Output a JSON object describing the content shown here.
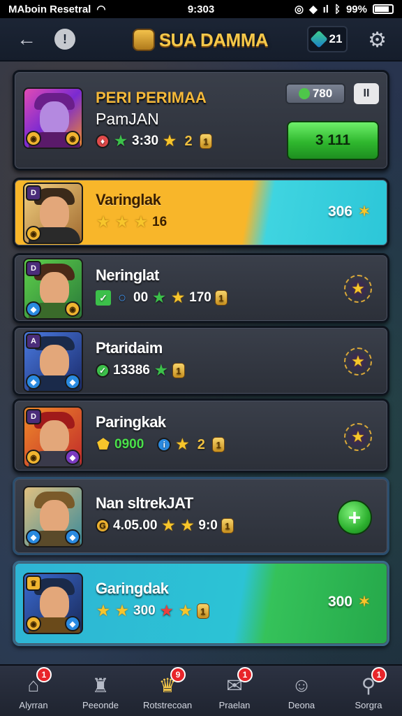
{
  "status_bar": {
    "carrier": "MAboin Resetral",
    "time": "9:303",
    "battery": "99%"
  },
  "header": {
    "title": "SUA DAMMA",
    "gems": "21"
  },
  "top_card": {
    "title_line1": "PERI PERIMAA",
    "title_line2": "PamJAN",
    "score": "3:30",
    "pill_value": "780",
    "pause_label": "II",
    "action_label": "3 111"
  },
  "cards": [
    {
      "name": "Varinglak",
      "stat": "16",
      "right_value": "306"
    },
    {
      "name": "Neringlat",
      "stat_a": "00",
      "stat_b": "170"
    },
    {
      "name": "Ptaridaim",
      "stat_a": "13386"
    },
    {
      "name": "Paringkak",
      "stat_a": "0900"
    },
    {
      "name": "Nan sltrekJAT",
      "stat_a": "4.05.00",
      "stat_b": "9:0"
    },
    {
      "name": "Garingdak",
      "stat_a": "300",
      "right_value": "300"
    }
  ],
  "bottom_nav": [
    {
      "label": "Alyrran",
      "badge": "1"
    },
    {
      "label": "Peeonde",
      "badge": ""
    },
    {
      "label": "Rotstrecoan",
      "badge": "9"
    },
    {
      "label": "Praelan",
      "badge": "1"
    },
    {
      "label": "Deona",
      "badge": ""
    },
    {
      "label": "Sorgra",
      "badge": "1"
    }
  ]
}
